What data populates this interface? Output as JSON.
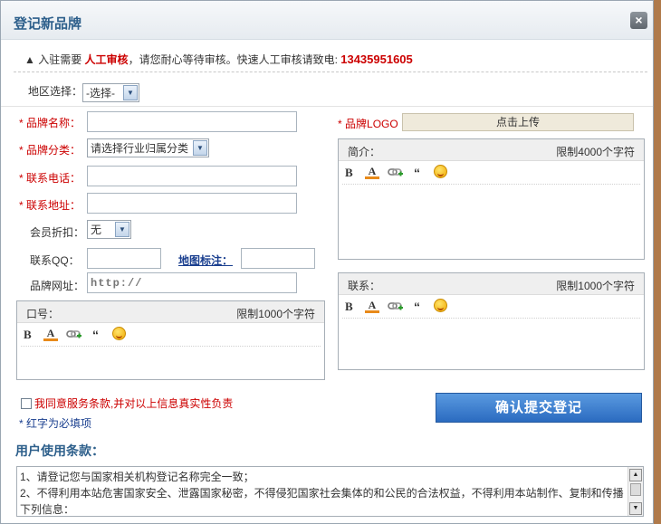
{
  "dialog": {
    "title": "登记新品牌",
    "close_label": "×"
  },
  "notice": {
    "prefix": "▲ 入驻需要 ",
    "highlight": "人工审核",
    "middle": "，请您耐心等待审核。快速人工审核请致电: ",
    "phone": "13435951605"
  },
  "region": {
    "label": "地区选择：",
    "selected": "-选择-"
  },
  "form": {
    "brand_name_label": "品牌名称：",
    "brand_category_label": "品牌分类：",
    "brand_category_selected": "请选择行业归属分类",
    "phone_label": "联系电话：",
    "address_label": "联系地址：",
    "discount_label": "会员折扣：",
    "discount_selected": "无",
    "qq_label": "联系QQ：",
    "map_label": "地图标注：",
    "website_label": "品牌网址：",
    "website_placeholder": "http://",
    "logo_label": "品牌LOGO",
    "upload_label": "点击上传",
    "star": "* "
  },
  "editors": {
    "slogan": {
      "title": "口号：",
      "limit": "限制1000个字符"
    },
    "intro": {
      "title": "简介：",
      "limit": "限制4000个字符"
    },
    "contact": {
      "title": "联系：",
      "limit": "限制1000个字符"
    },
    "toolbar": {
      "bold": "B",
      "color": "A",
      "quote": "“"
    }
  },
  "agreement": {
    "label": "我同意服务条款,并对以上信息真实性负责",
    "required_note": "* 红字为必填项",
    "submit_label": "确认提交登记"
  },
  "terms": {
    "title": "用户使用条款：",
    "line1": "1、请登记您与国家相关机构登记名称完全一致；",
    "line2": "2、不得利用本站危害国家安全、泄露国家秘密，不得侵犯国家社会集体的和公民的合法权益，不得利用本站制作、复制和传播",
    "line3": "下列信息："
  },
  "colors": {
    "title_blue": "#2d5f8b",
    "required_red": "#cc0000",
    "submit_blue": "#2b6bc0"
  }
}
